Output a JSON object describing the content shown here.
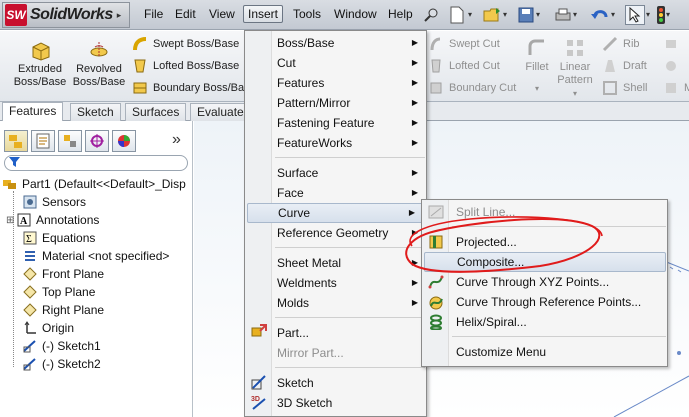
{
  "app": {
    "name": "SolidWorks",
    "logo_badge": "SW"
  },
  "menubar": {
    "items": [
      {
        "label": "File"
      },
      {
        "label": "Edit"
      },
      {
        "label": "View"
      },
      {
        "label": "Insert",
        "active": true
      },
      {
        "label": "Tools"
      },
      {
        "label": "Window"
      },
      {
        "label": "Help"
      }
    ]
  },
  "quick_access_icons": [
    "pin-icon",
    "new-document-icon",
    "open-folder-icon",
    "save-icon",
    "print-icon",
    "undo-icon",
    "select-arrow-icon",
    "rebuild-traffic-light-icon"
  ],
  "command_manager": {
    "big_buttons": [
      {
        "label": "Extruded Boss/Base",
        "line1": "Extruded",
        "line2": "Boss/Base"
      },
      {
        "label": "Revolved Boss/Base",
        "line1": "Revolved",
        "line2": "Boss/Base"
      }
    ],
    "small_buttons": [
      {
        "label": "Swept Boss/Base"
      },
      {
        "label": "Lofted Boss/Base"
      },
      {
        "label": "Boundary Boss/Ba"
      }
    ],
    "cut_buttons": [
      {
        "label": "Swept Cut"
      },
      {
        "label": "Lofted Cut"
      },
      {
        "label": "Boundary Cut"
      }
    ],
    "feature_buttons": [
      {
        "label": "Fillet"
      },
      {
        "label": "Linear Pattern",
        "line1": "Linear",
        "line2": "Pattern"
      },
      {
        "label": "Rib"
      },
      {
        "label": "Draft"
      },
      {
        "label": "Shell"
      },
      {
        "label": "M"
      }
    ]
  },
  "tabs": [
    {
      "label": "Features",
      "active": true
    },
    {
      "label": "Sketch"
    },
    {
      "label": "Surfaces"
    },
    {
      "label": "Evaluate"
    }
  ],
  "feature_manager": {
    "toolbar_icons": [
      "feature-manager-tree-icon",
      "property-manager-icon",
      "configuration-manager-icon",
      "dimxpert-manager-icon",
      "display-manager-icon"
    ],
    "expand_glyph": "»",
    "root": "Part1  (Default<<Default>_Disp",
    "items": [
      {
        "label": "Sensors",
        "icon": "sensor-icon"
      },
      {
        "label": "Annotations",
        "icon": "annotations-icon"
      },
      {
        "label": "Equations",
        "icon": "equations-icon"
      },
      {
        "label": "Material <not specified>",
        "icon": "material-icon"
      },
      {
        "label": "Front Plane",
        "icon": "plane-icon"
      },
      {
        "label": "Top Plane",
        "icon": "plane-icon"
      },
      {
        "label": "Right Plane",
        "icon": "plane-icon"
      },
      {
        "label": "Origin",
        "icon": "origin-icon"
      },
      {
        "label": "(-) Sketch1",
        "icon": "sketch-icon"
      },
      {
        "label": "(-) Sketch2",
        "icon": "sketch-icon"
      }
    ]
  },
  "insert_menu": {
    "items": [
      {
        "label": "Boss/Base",
        "submenu": true
      },
      {
        "label": "Cut",
        "submenu": true
      },
      {
        "label": "Features",
        "submenu": true
      },
      {
        "label": "Pattern/Mirror",
        "submenu": true
      },
      {
        "label": "Fastening Feature",
        "submenu": true
      },
      {
        "label": "FeatureWorks",
        "submenu": true
      },
      {
        "label": "Surface",
        "submenu": true
      },
      {
        "label": "Face",
        "submenu": true
      },
      {
        "label": "Curve",
        "submenu": true,
        "highlighted": true
      },
      {
        "label": "Reference Geometry",
        "submenu": true
      },
      {
        "label": "Sheet Metal",
        "submenu": true
      },
      {
        "label": "Weldments",
        "submenu": true
      },
      {
        "label": "Molds",
        "submenu": true
      },
      {
        "label": "Part..."
      },
      {
        "label": "Mirror Part...",
        "disabled": true
      },
      {
        "label": "Sketch"
      },
      {
        "label": "3D Sketch"
      }
    ]
  },
  "curve_submenu": {
    "items": [
      {
        "label": "Split Line...",
        "disabled": true
      },
      {
        "label": "Projected..."
      },
      {
        "label": "Composite...",
        "highlighted": true
      },
      {
        "label": "Curve Through XYZ Points..."
      },
      {
        "label": "Curve Through Reference Points..."
      },
      {
        "label": "Helix/Spiral..."
      },
      {
        "label": "Customize Menu"
      }
    ]
  },
  "colors": {
    "annotation_red": "#e01b1b",
    "menu_highlight": "#d7e0ec",
    "logo_red": "#c8102e"
  }
}
